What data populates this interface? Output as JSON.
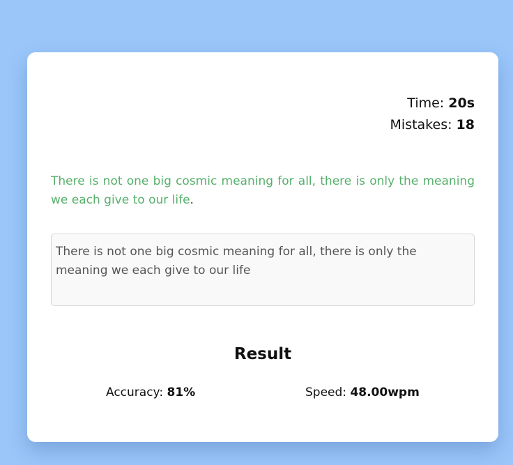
{
  "stats": {
    "time_label": "Time:",
    "time_value": "20s",
    "mistakes_label": "Mistakes:",
    "mistakes_value": "18"
  },
  "quote": {
    "text": "There is not one big cosmic meaning for all, there is only the meaning we each give to our life",
    "tail": "."
  },
  "input": {
    "value": "There is not one big cosmic meaning for all, there is only the meaning we each give to our life"
  },
  "result": {
    "title": "Result",
    "accuracy_label": "Accuracy:",
    "accuracy_value": "81%",
    "speed_label": "Speed:",
    "speed_value": "48.00wpm"
  },
  "colors": {
    "background": "#9ac6fa",
    "card": "#ffffff",
    "quote_correct": "#56b06b"
  }
}
